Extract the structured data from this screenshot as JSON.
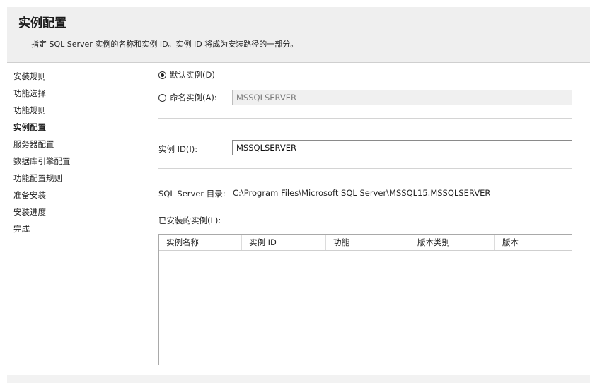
{
  "header": {
    "title": "实例配置",
    "subtitle": "指定 SQL Server 实例的名称和实例 ID。实例 ID 将成为安装路径的一部分。"
  },
  "sidebar": {
    "items": [
      {
        "label": "安装规则",
        "active": false
      },
      {
        "label": "功能选择",
        "active": false
      },
      {
        "label": "功能规则",
        "active": false
      },
      {
        "label": "实例配置",
        "active": true
      },
      {
        "label": "服务器配置",
        "active": false
      },
      {
        "label": "数据库引擎配置",
        "active": false
      },
      {
        "label": "功能配置规则",
        "active": false
      },
      {
        "label": "准备安装",
        "active": false
      },
      {
        "label": "安装进度",
        "active": false
      },
      {
        "label": "完成",
        "active": false
      }
    ]
  },
  "main": {
    "default_instance_label": "默认实例(D)",
    "default_instance_selected": true,
    "named_instance_label": "命名实例(A):",
    "named_instance_value": "MSSQLSERVER",
    "instance_id_label": "实例 ID(I):",
    "instance_id_value": "MSSQLSERVER",
    "sql_dir_label": "SQL Server 目录:",
    "sql_dir_value": "C:\\Program Files\\Microsoft SQL Server\\MSSQL15.MSSQLSERVER",
    "installed_instances_label": "已安装的实例(L):",
    "table": {
      "columns": [
        "实例名称",
        "实例 ID",
        "功能",
        "版本类别",
        "版本"
      ],
      "rows": []
    }
  }
}
